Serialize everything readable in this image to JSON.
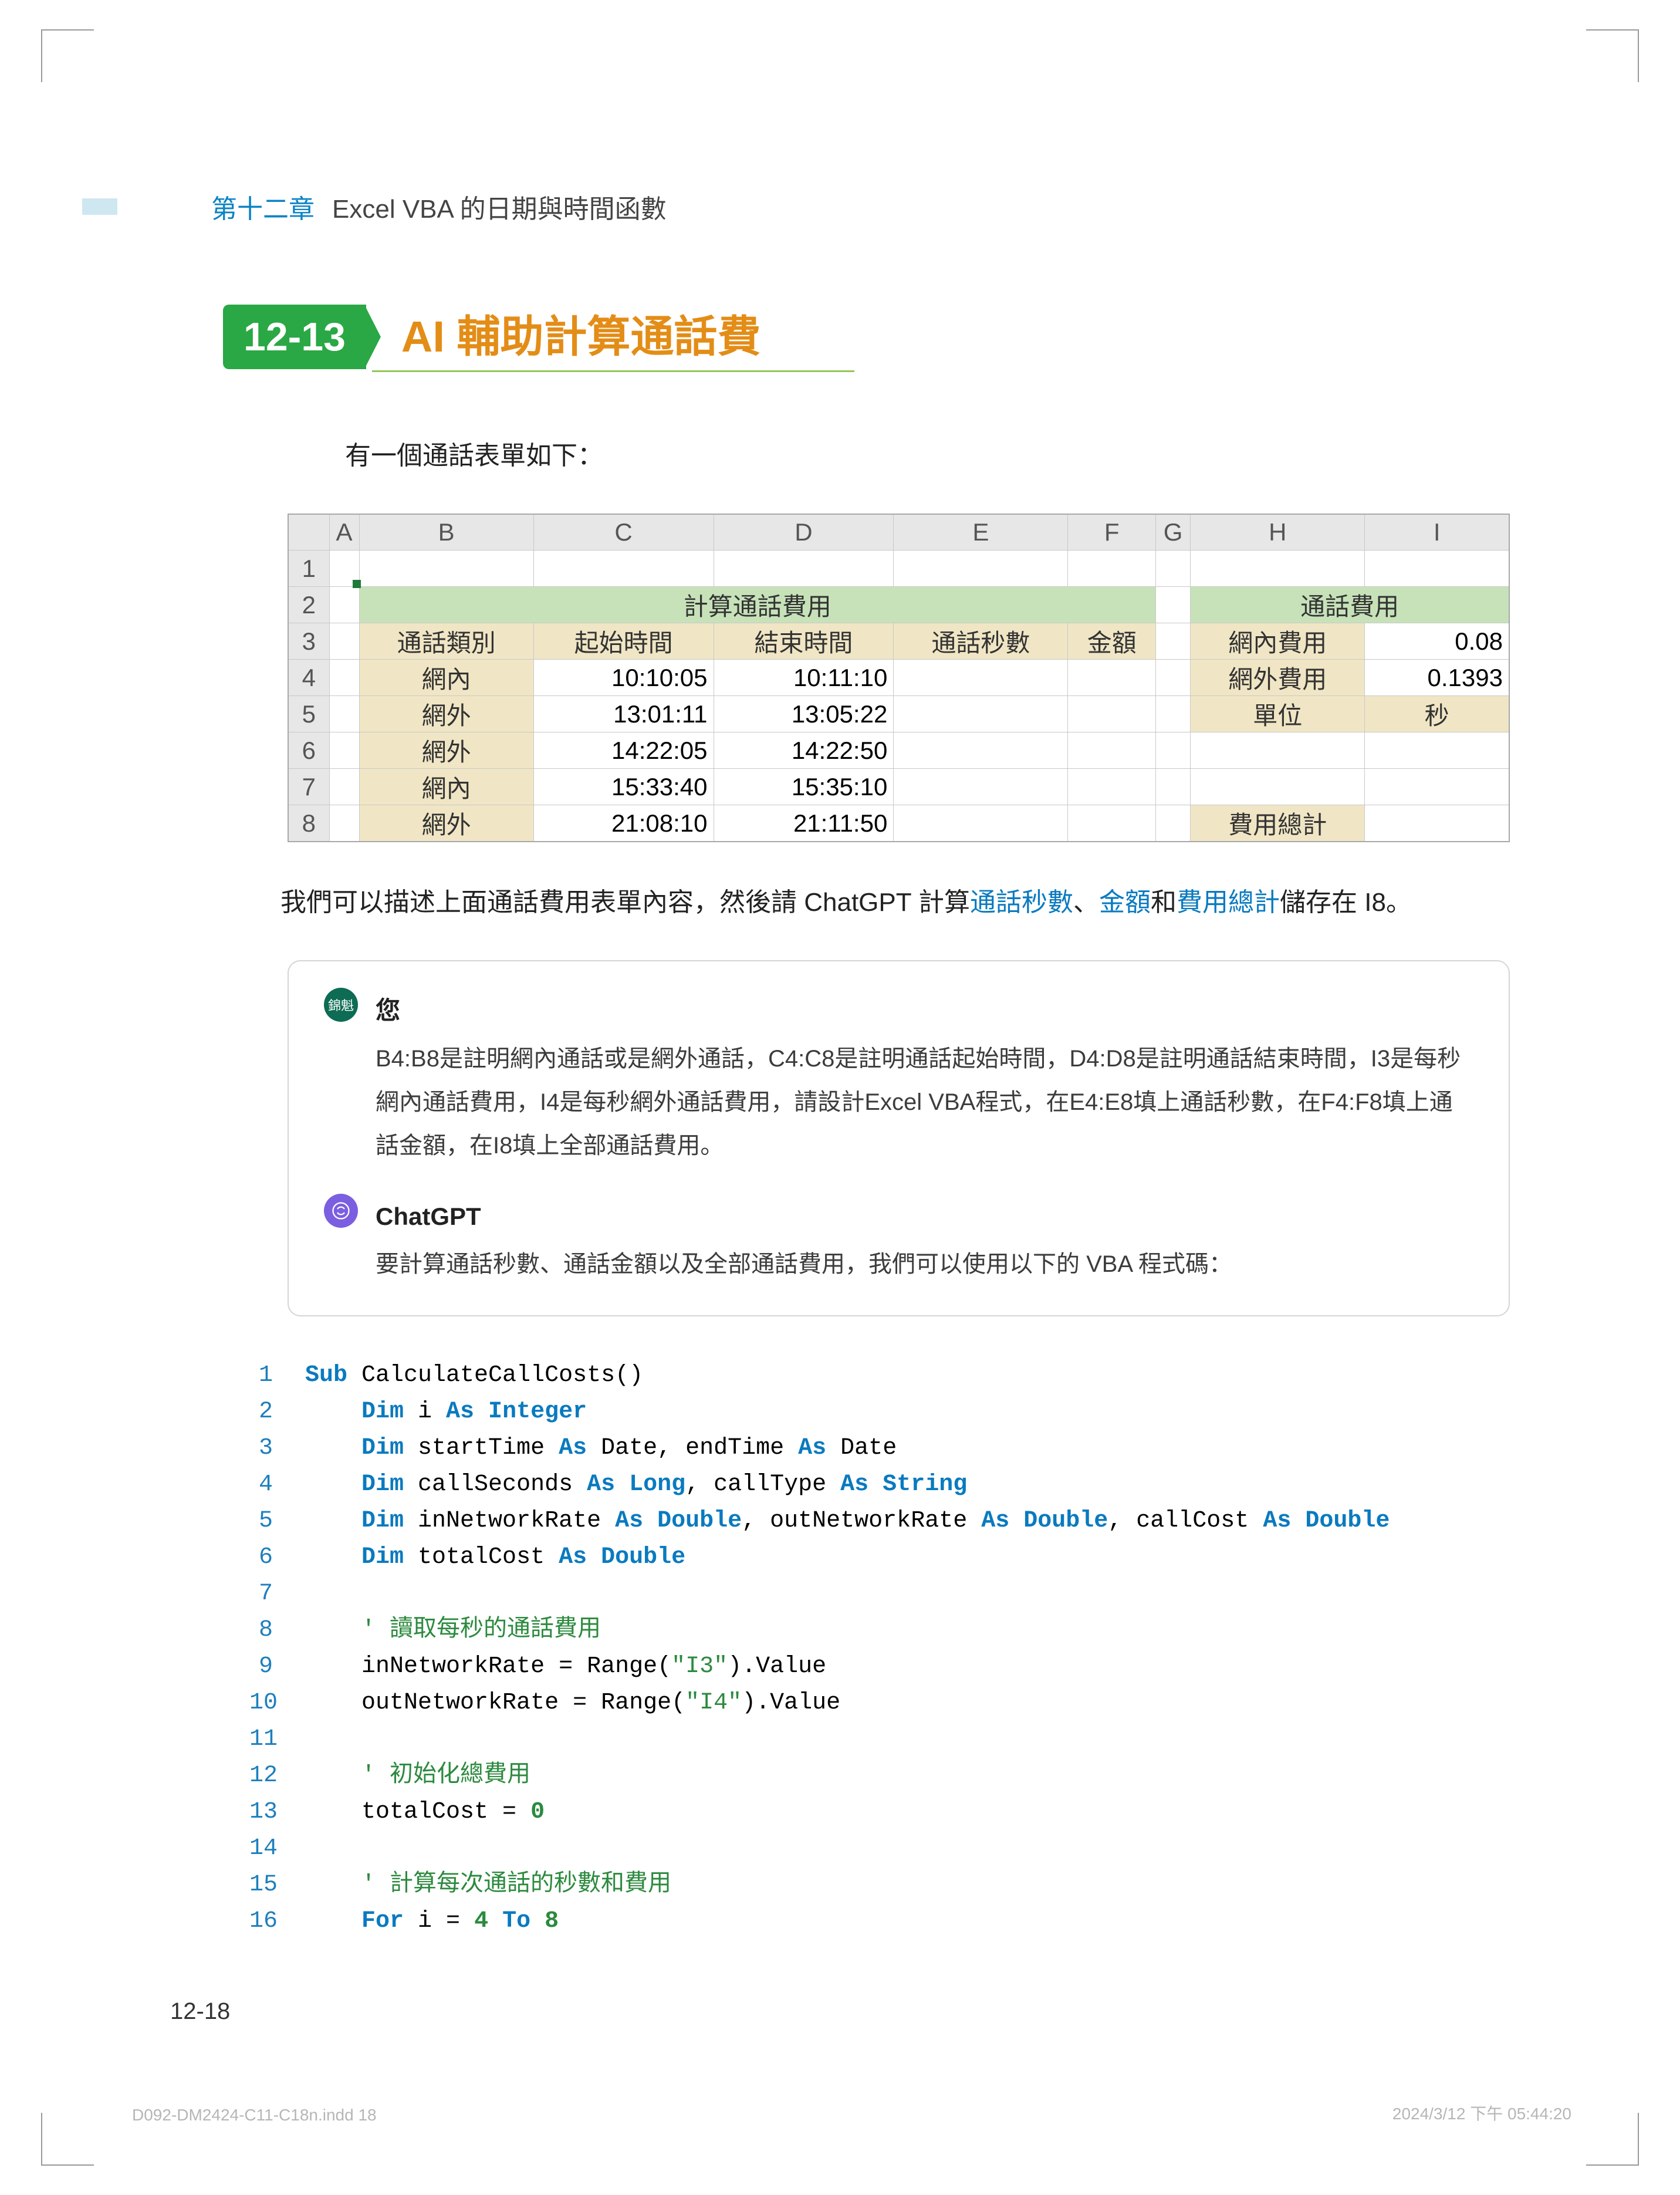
{
  "chapter": {
    "number": "第十二章",
    "title": "Excel VBA 的日期與時間函數"
  },
  "section": {
    "badge": "12-13",
    "title": "AI 輔助計算通話費"
  },
  "intro": "有一個通話表單如下：",
  "table": {
    "cols": [
      "A",
      "B",
      "C",
      "D",
      "E",
      "F",
      "G",
      "H",
      "I"
    ],
    "row_hdrs": [
      "1",
      "2",
      "3",
      "4",
      "5",
      "6",
      "7",
      "8"
    ],
    "title_left": "計算通話費用",
    "title_right": "通話費用",
    "hdr_left": [
      "通話類別",
      "起始時間",
      "結束時間",
      "通話秒數",
      "金額"
    ],
    "rows_left": [
      [
        "網內",
        "10:10:05",
        "10:11:10",
        "",
        ""
      ],
      [
        "網外",
        "13:01:11",
        "13:05:22",
        "",
        ""
      ],
      [
        "網外",
        "14:22:05",
        "14:22:50",
        "",
        ""
      ],
      [
        "網內",
        "15:33:40",
        "15:35:10",
        "",
        ""
      ],
      [
        "網外",
        "21:08:10",
        "21:11:50",
        "",
        ""
      ]
    ],
    "rows_right": [
      [
        "網內費用",
        "0.08"
      ],
      [
        "網外費用",
        "0.1393"
      ],
      [
        "單位",
        "秒"
      ],
      [
        "",
        ""
      ],
      [
        "費用總計",
        ""
      ]
    ]
  },
  "para2": {
    "p1a": "我們可以描述上面通話費用表單內容，然後請 ChatGPT 計算",
    "l1": "通話秒數",
    "c1": "、",
    "l2": "金額",
    "c2": "和",
    "l3": "費用總計",
    "p1b": "儲存在 I8。"
  },
  "chat": {
    "user_label": "您",
    "user_avatar": "錦魁",
    "user_text": "B4:B8是註明網內通話或是網外通話，C4:C8是註明通話起始時間，D4:D8是註明通話結束時間，I3是每秒網內通話費用，I4是每秒網外通話費用，請設計Excel VBA程式，在E4:E8填上通話秒數，在F4:F8填上通話金額，在I8填上全部通話費用。",
    "gpt_label": "ChatGPT",
    "gpt_text": "要計算通話秒數、通話金額以及全部通話費用，我們可以使用以下的 VBA 程式碼："
  },
  "code": [
    {
      "n": "1",
      "html": "<span class='kw'>Sub</span> CalculateCallCosts()"
    },
    {
      "n": "2",
      "html": "    <span class='kw'>Dim</span> i <span class='kw'>As Integer</span>"
    },
    {
      "n": "3",
      "html": "    <span class='kw'>Dim</span> startTime <span class='kw'>As</span> Date, endTime <span class='kw'>As</span> Date"
    },
    {
      "n": "4",
      "html": "    <span class='kw'>Dim</span> callSeconds <span class='kw'>As Long</span>, callType <span class='kw'>As String</span>"
    },
    {
      "n": "5",
      "html": "    <span class='kw'>Dim</span> inNetworkRate <span class='kw'>As Double</span>, outNetworkRate <span class='kw'>As Double</span>, callCost <span class='kw'>As Double</span>"
    },
    {
      "n": "6",
      "html": "    <span class='kw'>Dim</span> totalCost <span class='kw'>As Double</span>"
    },
    {
      "n": "7",
      "html": ""
    },
    {
      "n": "8",
      "html": "    <span class='cmt'>' 讀取每秒的通話費用</span>"
    },
    {
      "n": "9",
      "html": "    inNetworkRate = Range(<span class='str'>\"I3\"</span>).Value"
    },
    {
      "n": "10",
      "html": "    outNetworkRate = Range(<span class='str'>\"I4\"</span>).Value"
    },
    {
      "n": "11",
      "html": ""
    },
    {
      "n": "12",
      "html": "    <span class='cmt'>' 初始化總費用</span>"
    },
    {
      "n": "13",
      "html": "    totalCost = <span class='num'>0</span>"
    },
    {
      "n": "14",
      "html": ""
    },
    {
      "n": "15",
      "html": "    <span class='cmt'>' 計算每次通話的秒數和費用</span>"
    },
    {
      "n": "16",
      "html": "    <span class='kw'>For</span> i = <span class='num'>4</span> <span class='kw'>To</span> <span class='num'>8</span>"
    }
  ],
  "page_num": "12-18",
  "footer_left": "D092-DM2424-C11-C18n.indd   18",
  "footer_right": "2024/3/12   下午 05:44:20"
}
